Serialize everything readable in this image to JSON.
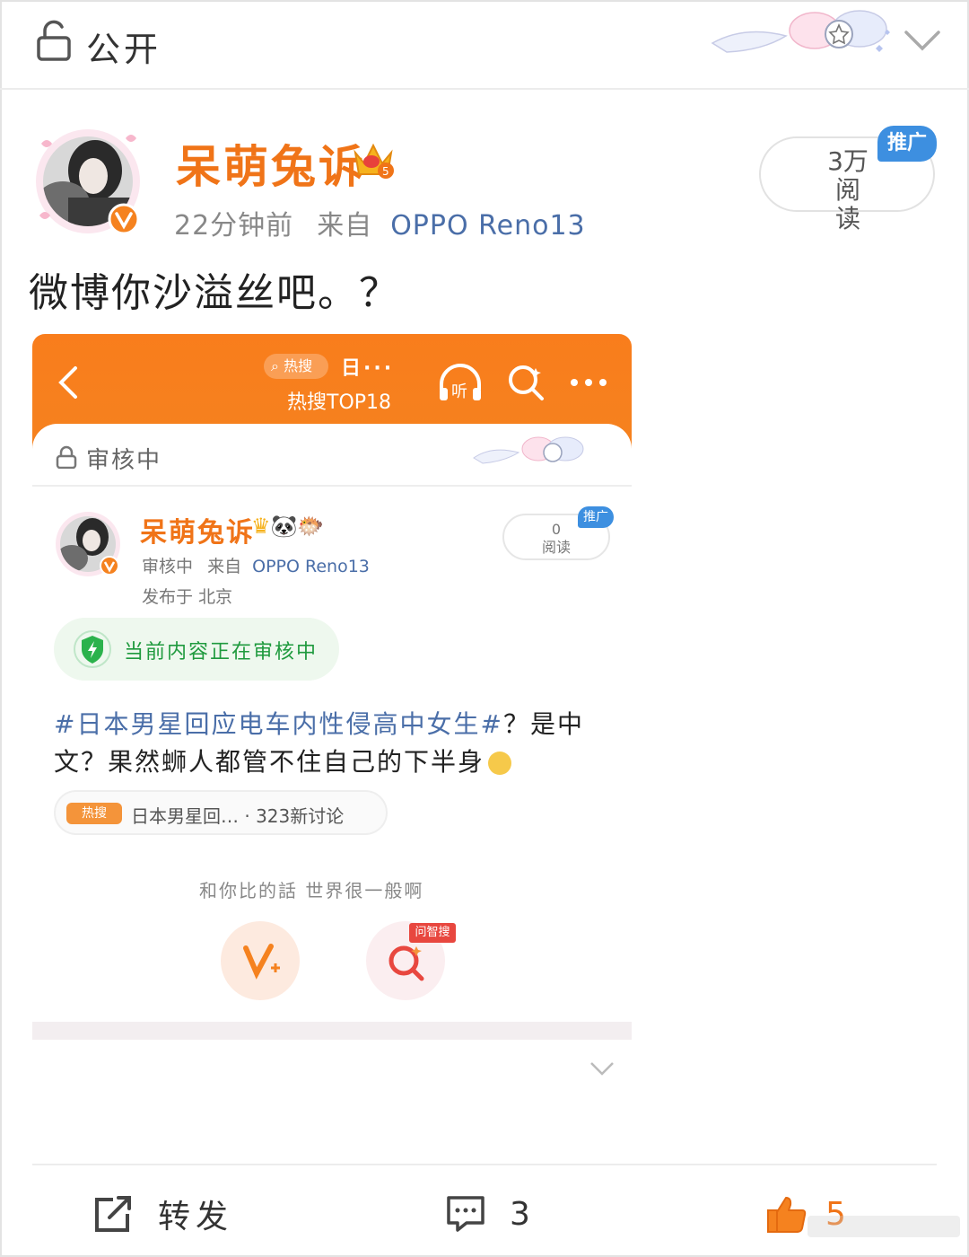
{
  "topbar": {
    "privacy_label": "公开"
  },
  "post": {
    "username": "呆萌兔诉",
    "time": "22分钟前",
    "from_label": "来自",
    "device": "OPPO Reno13",
    "reads": "3万\n阅读",
    "promo_label": "推广",
    "text": "微博你沙溢丝吧。？"
  },
  "screenshot": {
    "hot_label": "热搜",
    "day_label": "日···",
    "top_rank": "热搜TOP18",
    "listen_label": "听",
    "status": "审核中",
    "username": "呆萌兔诉",
    "emojis": "🐼🐡",
    "meta_status": "审核中",
    "meta_from": "来自",
    "meta_device": "OPPO Reno13",
    "location": "发布于 北京",
    "reads": "0\n阅读",
    "promo_label": "推广",
    "review_notice": "当前内容正在审核中",
    "content_tag": "#日本男星回应电车内性侵高中女生#",
    "content_text": "？是中文？果然蛳人都管不住自己的下半身",
    "topic_badge": "热搜",
    "topic_text": "日本男星回… · 323新讨论",
    "signature": "和你比的話 世界很一般啊",
    "ask_badge": "问智搜"
  },
  "actions": {
    "repost_label": "转发",
    "comment_count": "3",
    "like_count": "5"
  },
  "colors": {
    "brand_orange": "#f07418",
    "header_orange": "#f97d1c",
    "link_blue": "#4a6ea8",
    "promo_blue": "#3d8fe0",
    "review_green": "#1f9a3e"
  }
}
